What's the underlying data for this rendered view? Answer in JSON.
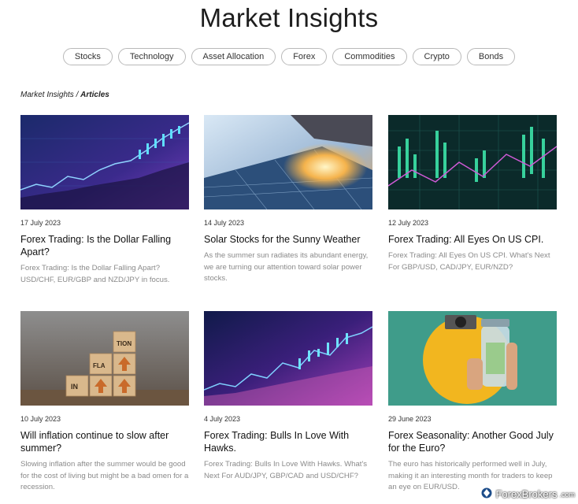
{
  "page": {
    "title": "Market Insights"
  },
  "filters": [
    "Stocks",
    "Technology",
    "Asset Allocation",
    "Forex",
    "Commodities",
    "Crypto",
    "Bonds"
  ],
  "breadcrumb": {
    "root": "Market Insights",
    "separator": " / ",
    "current": "Articles"
  },
  "articles": [
    {
      "date": "17 July 2023",
      "title": "Forex Trading: Is the Dollar Falling Apart?",
      "excerpt": "Forex Trading: Is the Dollar Falling Apart? USD/CHF, EUR/GBP and NZD/JPY in focus.",
      "image": "chart-purple-candles-image"
    },
    {
      "date": "14 July 2023",
      "title": "Solar Stocks for the Sunny Weather",
      "excerpt": "As the summer sun radiates its abundant energy, we are turning our attention toward solar power stocks.",
      "image": "solar-panels-image"
    },
    {
      "date": "12 July 2023",
      "title": "Forex Trading: All Eyes On US CPI.",
      "excerpt": "Forex Trading: All Eyes On US CPI. What's Next For GBP/USD, CAD/JPY, EUR/NZD?",
      "image": "green-trading-screen-image"
    },
    {
      "date": "10 July 2023",
      "title": "Will inflation continue to slow after summer?",
      "excerpt": "Slowing inflation after the summer would be good for the cost of living but might be a bad omen for a recession.",
      "image": "inflation-blocks-image",
      "image_text": [
        "IN",
        "FLA",
        "TION"
      ]
    },
    {
      "date": "4 July 2023",
      "title": "Forex Trading: Bulls In Love With Hawks.",
      "excerpt": "Forex Trading: Bulls In Love With Hawks. What's Next For AUD/JPY, GBP/CAD and USD/CHF?",
      "image": "chart-purple-candles-image"
    },
    {
      "date": "29 June 2023",
      "title": "Forex Seasonality: Another Good July for the Euro?",
      "excerpt": "The euro has historically performed well in July, making it an interesting month for traders to keep an eye on EUR/USD.",
      "image": "savings-jar-image"
    }
  ],
  "watermark": {
    "brand": "ForexBrokers",
    "suffix": ".com"
  },
  "colors": {
    "pill_border": "#b9b9b9",
    "excerpt": "#8a8a8a"
  }
}
